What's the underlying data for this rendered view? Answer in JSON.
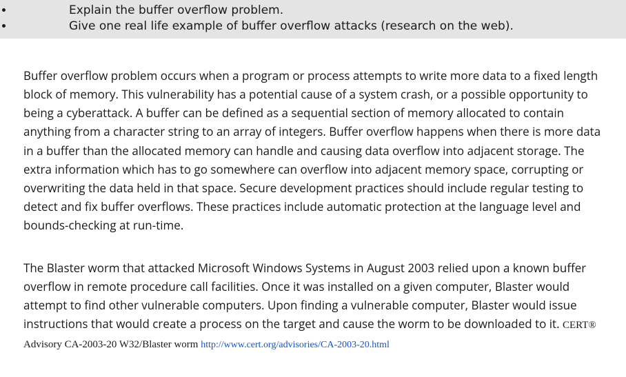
{
  "prompt": {
    "items": [
      "Explain the buffer overflow problem.",
      "Give one real life example of buffer overflow attacks (research on the web)."
    ]
  },
  "answer": {
    "para1": "Buffer overflow problem occurs when a program or process attempts to write more data to a fixed length block of memory. This vulnerability has a potential cause of a system crash, or a possible opportunity to being a cyberattack.  A buffer can be defined as a sequential section of memory allocated to contain anything from a character string to an array of integers. Buffer overflow happens when there is more data in a buffer than the allocated memory can handle and causing data overflow into adjacent storage. The extra information which has to go somewhere can overflow into adjacent memory space, corrupting or overwriting the data held in that space. Secure development practices should include regular testing to detect and fix buffer overflows. These practices include automatic protection at the language level and bounds-checking at run-time.",
    "para2_text": "The Blaster worm that attacked Microsoft Windows Systems in August 2003 relied upon a known buffer overflow in remote procedure call facilities. Once it was installed on a given computer, Blaster would attempt to find other vulnerable computers. Upon finding a vulnerable computer, Blaster would issue instructions that would create a process on the target and cause the worm to be downloaded to it. ",
    "citation": "CERT® Advisory CA-2003-20 W32/Blaster worm ",
    "link_text": "http://www.cert.org/advisories/CA-2003-20.html",
    "link_href": "http://www.cert.org/advisories/CA-2003-20.html"
  }
}
